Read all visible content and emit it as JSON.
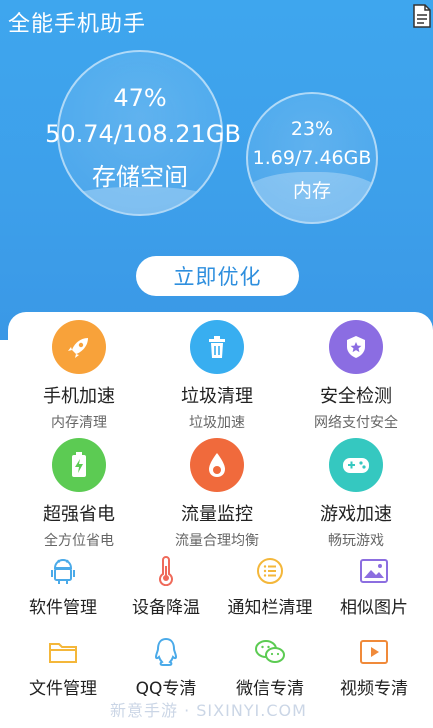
{
  "header": {
    "title": "全能手机助手"
  },
  "storage": {
    "percent": "47%",
    "size": "50.74/108.21GB",
    "label": "存储空间"
  },
  "memory": {
    "percent": "23%",
    "size": "1.69/7.46GB",
    "label": "内存"
  },
  "optimize_button": {
    "label": "立即优化"
  },
  "main_features": [
    {
      "title": "手机加速",
      "subtitle": "内存清理",
      "icon": "rocket-icon",
      "color": "#f8a23a"
    },
    {
      "title": "垃圾清理",
      "subtitle": "垃圾加速",
      "icon": "trash-icon",
      "color": "#38aef0"
    },
    {
      "title": "安全检测",
      "subtitle": "网络支付安全",
      "icon": "shield-star-icon",
      "color": "#8b6de2"
    },
    {
      "title": "超强省电",
      "subtitle": "全方位省电",
      "icon": "battery-icon",
      "color": "#5ccb53"
    },
    {
      "title": "流量监控",
      "subtitle": "流量合理均衡",
      "icon": "drop-icon",
      "color": "#f06a3c"
    },
    {
      "title": "游戏加速",
      "subtitle": "畅玩游戏",
      "icon": "gamepad-icon",
      "color": "#35c8c0"
    }
  ],
  "tools": [
    {
      "label": "软件管理",
      "icon": "android-icon",
      "color": "#4aaae9"
    },
    {
      "label": "设备降温",
      "icon": "thermometer-icon",
      "color": "#ef6a5a"
    },
    {
      "label": "通知栏清理",
      "icon": "list-icon",
      "color": "#f4b73a"
    },
    {
      "label": "相似图片",
      "icon": "image-icon",
      "color": "#8c6ee0"
    },
    {
      "label": "文件管理",
      "icon": "folder-icon",
      "color": "#f4b73a"
    },
    {
      "label": "QQ专清",
      "icon": "qq-icon",
      "color": "#4aaae9"
    },
    {
      "label": "微信专清",
      "icon": "wechat-icon",
      "color": "#5ccb53"
    },
    {
      "label": "视频专清",
      "icon": "video-icon",
      "color": "#f08a3a"
    }
  ],
  "watermark": "新意手游 · SIXINYI.COM"
}
